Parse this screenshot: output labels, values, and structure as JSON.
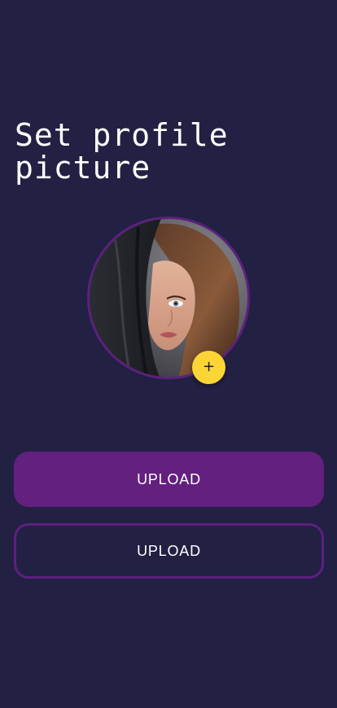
{
  "page": {
    "title": "Set profile picture"
  },
  "avatar": {
    "image": "profile-photo-woman",
    "add_icon": "+"
  },
  "buttons": {
    "primary_label": "UPLOAD",
    "secondary_label": "UPLOAD"
  },
  "colors": {
    "background": "#222043",
    "accent_purple": "#63207f",
    "fab_yellow": "#fbd535"
  }
}
